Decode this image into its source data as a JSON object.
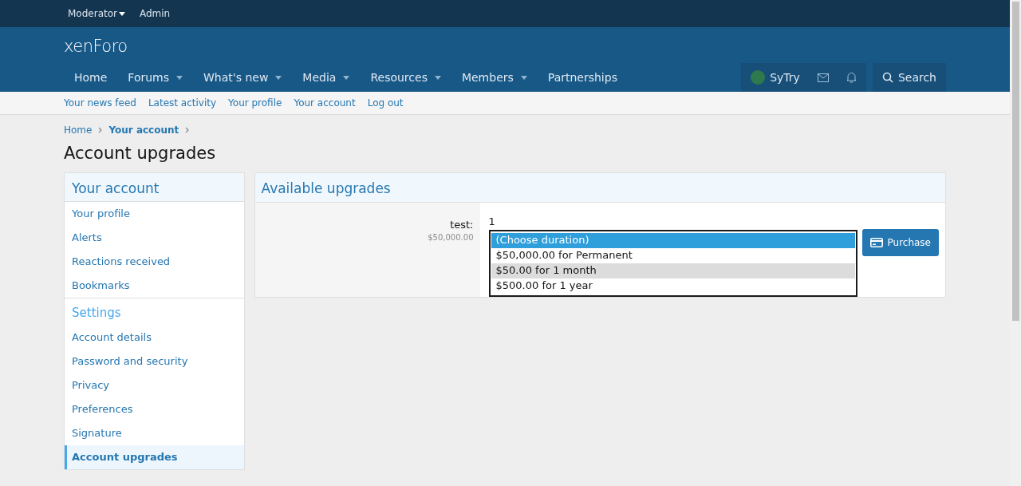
{
  "staff_bar": [
    {
      "label": "Moderator",
      "has_menu": true
    },
    {
      "label": "Admin",
      "has_menu": false
    }
  ],
  "logo": {
    "text": "xenForo"
  },
  "nav": [
    {
      "label": "Home",
      "has_menu": false
    },
    {
      "label": "Forums",
      "has_menu": true
    },
    {
      "label": "What's new",
      "has_menu": true
    },
    {
      "label": "Media",
      "has_menu": true
    },
    {
      "label": "Resources",
      "has_menu": true
    },
    {
      "label": "Members",
      "has_menu": true
    },
    {
      "label": "Partnerships",
      "has_menu": false
    }
  ],
  "user": {
    "name": "SyTry"
  },
  "search": {
    "label": "Search"
  },
  "sub_nav": [
    "Your news feed",
    "Latest activity",
    "Your profile",
    "Your account",
    "Log out"
  ],
  "breadcrumb": [
    {
      "label": "Home",
      "current": false
    },
    {
      "label": "Your account",
      "current": true
    }
  ],
  "page_title": "Account upgrades",
  "sidebar": [
    {
      "title": "Your account",
      "items": [
        {
          "label": "Your profile",
          "selected": false
        },
        {
          "label": "Alerts",
          "selected": false
        },
        {
          "label": "Reactions received",
          "selected": false
        },
        {
          "label": "Bookmarks",
          "selected": false
        }
      ]
    },
    {
      "title": "Settings",
      "items": [
        {
          "label": "Account details",
          "selected": false
        },
        {
          "label": "Password and security",
          "selected": false
        },
        {
          "label": "Privacy",
          "selected": false
        },
        {
          "label": "Preferences",
          "selected": false
        },
        {
          "label": "Signature",
          "selected": false
        },
        {
          "label": "Account upgrades",
          "selected": true
        }
      ]
    }
  ],
  "panel": {
    "title": "Available upgrades",
    "upgrade": {
      "label": "test:",
      "price": "$50,000.00",
      "value": "1",
      "options": [
        {
          "label": "(Choose duration)",
          "selected": true,
          "hovered": false
        },
        {
          "label": "$50,000.00 for Permanent",
          "selected": false,
          "hovered": false
        },
        {
          "label": "$50.00 for 1 month",
          "selected": false,
          "hovered": true
        },
        {
          "label": "$500.00 for 1 year",
          "selected": false,
          "hovered": false
        }
      ],
      "button": "Purchase"
    }
  }
}
